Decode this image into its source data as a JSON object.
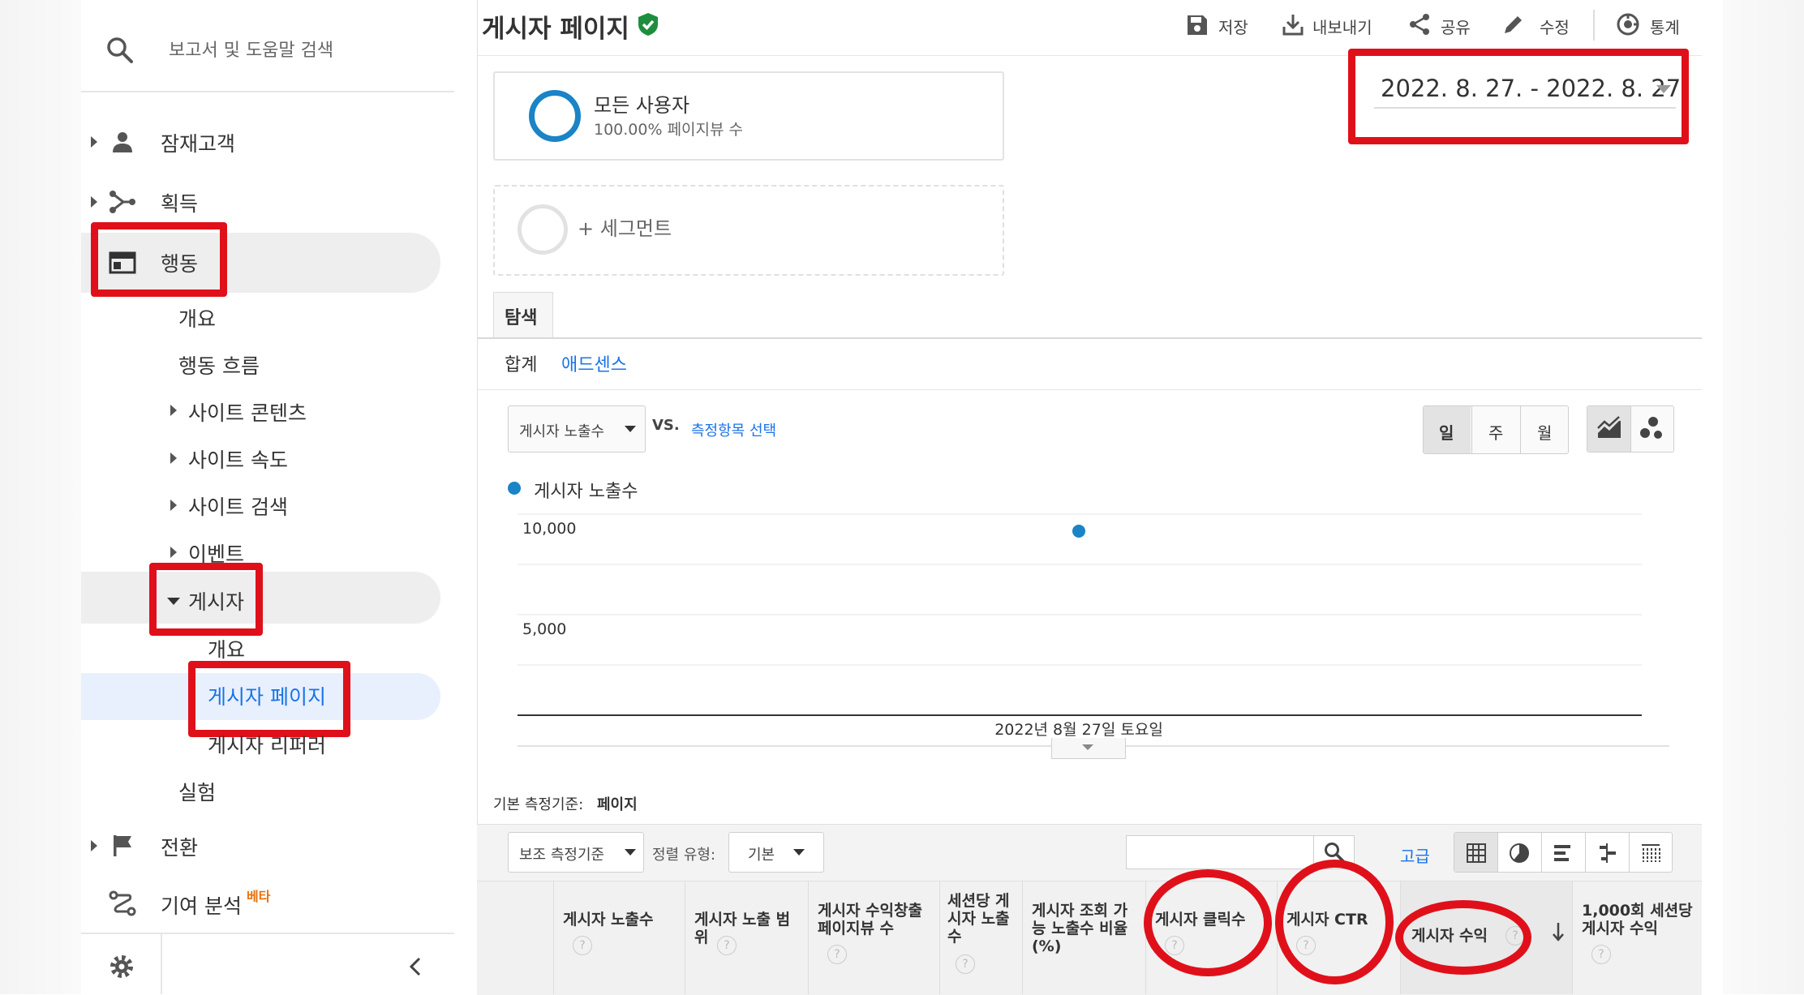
{
  "search": {
    "placeholder": "보고서 및 도움말 검색"
  },
  "sidebar": {
    "items": [
      {
        "label": "잠재고객"
      },
      {
        "label": "획득"
      },
      {
        "label": "행동"
      },
      {
        "label": "개요"
      },
      {
        "label": "행동 흐름"
      },
      {
        "label": "사이트 콘텐츠"
      },
      {
        "label": "사이트 속도"
      },
      {
        "label": "사이트 검색"
      },
      {
        "label": "이벤트"
      },
      {
        "label": "게시자"
      },
      {
        "label": "개요"
      },
      {
        "label": "게시자 페이지"
      },
      {
        "label": "게시자 리퍼러"
      },
      {
        "label": "실험"
      },
      {
        "label": "전환"
      },
      {
        "label": "기여 분석",
        "badge": "베타"
      }
    ]
  },
  "header": {
    "title": "게시자 페이지",
    "actions": {
      "save": "저장",
      "export": "내보내기",
      "share": "공유",
      "edit": "수정",
      "insights": "통계"
    }
  },
  "date_range": "2022. 8. 27. - 2022. 8. 27.",
  "segments": {
    "all_users": {
      "name": "모든 사용자",
      "sub": "100.00% 페이지뷰 수"
    },
    "add_segment": "+ 세그먼트"
  },
  "tabs": {
    "explore": "탐색",
    "summary": "합계",
    "adsense": "애드센스"
  },
  "chart_controls": {
    "metric": "게시자 노출수",
    "vs": "VS.",
    "select_metric": "측정항목 선택",
    "periods": [
      "일",
      "주",
      "월"
    ]
  },
  "chart_data": {
    "type": "line",
    "series": [
      {
        "name": "게시자 노출수",
        "values": [
          9800
        ]
      }
    ],
    "categories": [
      "2022년 8월 27일 토요일"
    ],
    "y_ticks": [
      "10,000",
      "5,000"
    ],
    "ylim": [
      0,
      10000
    ],
    "color": "#1a84c6"
  },
  "table_controls": {
    "primary_dimension_label": "기본 측정기준:",
    "primary_dimension_value": "페이지",
    "secondary_dimension": "보조 측정기준",
    "sort_label": "정렬 유형:",
    "sort_value": "기본",
    "advanced": "고급"
  },
  "table_headers": [
    "게시자 노출수",
    "게시자 노출 범위",
    "게시자 수익창출 페이지뷰 수",
    "세션당 게시자 노출수",
    "게시자 조회 가능 노출수 비율 (%)",
    "게시자 클릭수",
    "게시자 CTR",
    "게시자 수익",
    "1,000회 세션당 게시자 수익"
  ],
  "colors": {
    "accent": "#1a73e8",
    "annotation": "#e0101a",
    "verified": "#1e8e3e"
  }
}
